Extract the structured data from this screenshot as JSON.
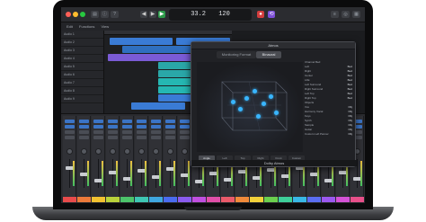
{
  "transport": {
    "position": "33.2",
    "tempo": "120"
  },
  "menubar": {
    "items": [
      "Edit",
      "Functions",
      "View"
    ]
  },
  "tracks": [
    {
      "name": "Audio 1"
    },
    {
      "name": "Audio 2"
    },
    {
      "name": "Audio 3"
    },
    {
      "name": "Audio 4"
    },
    {
      "name": "Audio 5"
    },
    {
      "name": "Audio 6"
    },
    {
      "name": "Audio 7"
    },
    {
      "name": "Audio 8"
    },
    {
      "name": "Audio 9"
    }
  ],
  "mixer": {
    "strip_colors": [
      "#e94b4b",
      "#ec7a3a",
      "#f2c230",
      "#b9d23a",
      "#4cc46a",
      "#3ec7b3",
      "#3fa7e0",
      "#4a6cf0",
      "#8a5bef",
      "#c04fe0",
      "#e04fa8",
      "#ea5a6a",
      "#f08a3a",
      "#f2d13a",
      "#6bd04e",
      "#3ecf9a",
      "#38b8e6",
      "#5a6ef2",
      "#9b58f0",
      "#d452d6",
      "#e8508a"
    ]
  },
  "atmos": {
    "window_title": "Atmos",
    "tabs": [
      "Monitoring Format",
      "Binaural"
    ],
    "objects_heading": "Channel Bed",
    "beds": [
      {
        "label": "Left",
        "value": "Bed"
      },
      {
        "label": "Right",
        "value": "Bed"
      },
      {
        "label": "Center",
        "value": "Bed"
      },
      {
        "label": "LFE",
        "value": "Bed"
      },
      {
        "label": "Left Surround",
        "value": "Bed"
      },
      {
        "label": "Right Surround",
        "value": "Bed"
      },
      {
        "label": "Left Top",
        "value": "Bed"
      },
      {
        "label": "Right Top",
        "value": "Bed"
      }
    ],
    "objects_label": "Objects",
    "objects": [
      {
        "label": "Vox",
        "value": "Obj"
      },
      {
        "label": "Harmony Vocal",
        "value": "Obj"
      },
      {
        "label": "Keys",
        "value": "Obj"
      },
      {
        "label": "Synth",
        "value": "Obj"
      },
      {
        "label": "Sample",
        "value": "Obj"
      },
      {
        "label": "Guitar",
        "value": "Obj"
      },
      {
        "label": "Custom Left Panner",
        "value": "Obj"
      }
    ],
    "view_tabs": [
      "Angle",
      "Left",
      "Top",
      "Right",
      "Front",
      "Custom"
    ],
    "footer": "Dolby Atmos"
  }
}
